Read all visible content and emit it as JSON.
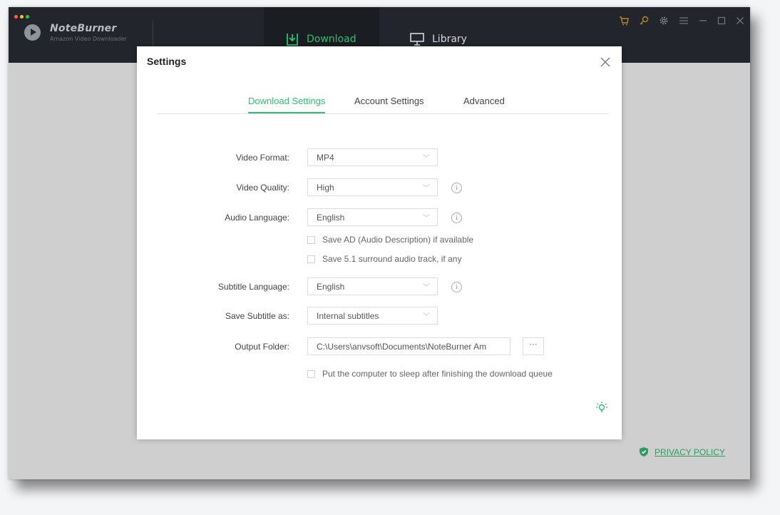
{
  "app": {
    "name": "NoteBurner",
    "subtitle": "Amazon Video Downloader"
  },
  "nav": {
    "download": "Download",
    "library": "Library"
  },
  "footer": {
    "privacy": "PRIVACY POLICY"
  },
  "dialog": {
    "title": "Settings",
    "tabs": [
      "Download Settings",
      "Account Settings",
      "Advanced"
    ],
    "fields": {
      "video_format": {
        "label": "Video Format:",
        "value": "MP4"
      },
      "video_quality": {
        "label": "Video Quality:",
        "value": "High"
      },
      "audio_language": {
        "label": "Audio Language:",
        "value": "English"
      },
      "subtitle_language": {
        "label": "Subtitle Language:",
        "value": "English"
      },
      "save_subtitle_as": {
        "label": "Save Subtitle as:",
        "value": "Internal subtitles"
      },
      "output_folder": {
        "label": "Output Folder:",
        "value": "C:\\Users\\anvsoft\\Documents\\NoteBurner Am",
        "browse": "···"
      }
    },
    "checkboxes": {
      "save_ad": "Save AD (Audio Description) if available",
      "save_51": "Save 5.1 surround audio track, if any",
      "sleep": "Put the computer to sleep after finishing the download queue"
    },
    "info_glyph": "i"
  },
  "colors": {
    "accent": "#2fbf71",
    "titlebar": "#22252b",
    "backdrop": "#cfcfcf"
  },
  "icons": [
    "download-icon",
    "library-icon",
    "cart-icon",
    "key-icon",
    "gear-icon",
    "menu-icon",
    "minimize-icon",
    "maximize-icon",
    "close-icon",
    "shield-icon",
    "lightbulb-icon",
    "chevron-down-icon",
    "info-icon"
  ]
}
